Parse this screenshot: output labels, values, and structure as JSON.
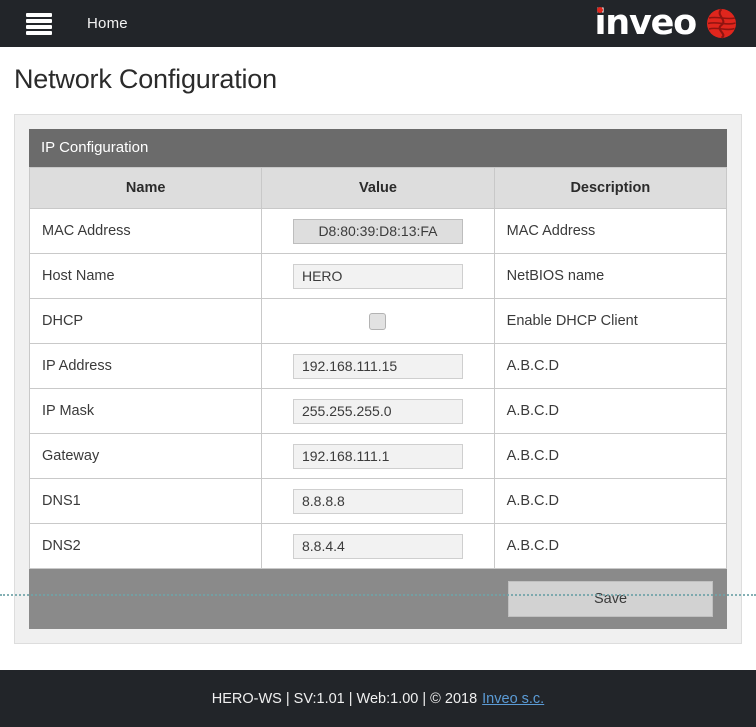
{
  "navbar": {
    "menu_icon": "hamburger-icon",
    "home_label": "Home",
    "brand_word": "inveo",
    "brand_mark": "inveo-globe-icon"
  },
  "page": {
    "title": "Network Configuration"
  },
  "panel": {
    "heading": "IP Configuration",
    "columns": [
      "Name",
      "Value",
      "Description"
    ],
    "rows": [
      {
        "name": "MAC Address",
        "control": "text-readonly",
        "value": "D8:80:39:D8:13:FA",
        "description": "MAC Address"
      },
      {
        "name": "Host Name",
        "control": "text",
        "value": "HERO",
        "description": "NetBIOS name"
      },
      {
        "name": "DHCP",
        "control": "checkbox",
        "value": "",
        "checked": false,
        "description": "Enable DHCP Client"
      },
      {
        "name": "IP Address",
        "control": "text",
        "value": "192.168.111.15",
        "description": "A.B.C.D"
      },
      {
        "name": "IP Mask",
        "control": "text",
        "value": "255.255.255.0",
        "description": "A.B.C.D"
      },
      {
        "name": "Gateway",
        "control": "text",
        "value": "192.168.111.1",
        "description": "A.B.C.D"
      },
      {
        "name": "DNS1",
        "control": "text",
        "value": "8.8.8.8",
        "description": "A.B.C.D"
      },
      {
        "name": "DNS2",
        "control": "text",
        "value": "8.8.4.4",
        "description": "A.B.C.D"
      }
    ],
    "save_label": "Save"
  },
  "footer": {
    "text": "HERO-WS | SV:1.01 | Web:1.00 | © 2018",
    "link_label": "Inveo s.c."
  },
  "colors": {
    "navbar_bg": "#222529",
    "brand_red": "#e0261d",
    "panel_head_bg": "#6b6b6b",
    "actionbar_bg": "#8a8a8a",
    "table_header_bg": "#dddddd",
    "link_blue": "#5b9bd5"
  }
}
